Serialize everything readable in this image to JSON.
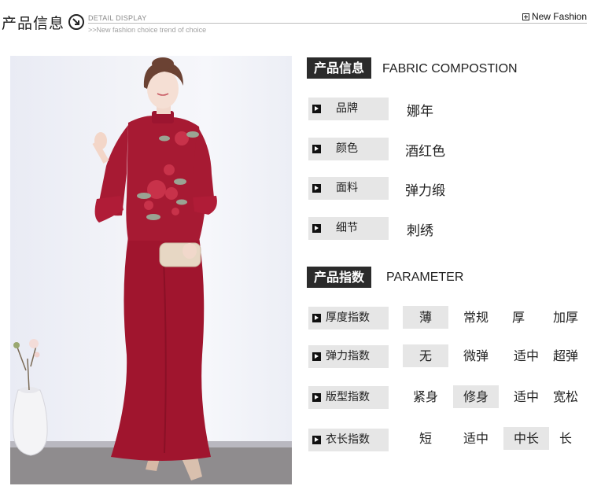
{
  "header": {
    "title": "产品信息",
    "en_line1": "DETAIL DISPLAY",
    "en_line2": ">>New fashion choice  trend of choice",
    "right_label": "New Fashion"
  },
  "product_info": {
    "tag": "产品信息",
    "title_en": "FABRIC COMPOSTION",
    "rows": [
      {
        "label": "品牌",
        "value": "娜年"
      },
      {
        "label": "颜色",
        "value": "酒红色"
      },
      {
        "label": "面料",
        "value": "弹力缎"
      },
      {
        "label": "细节",
        "value": "刺绣"
      }
    ]
  },
  "parameters": {
    "tag": "产品指数",
    "title_en": "PARAMETER",
    "rows": [
      {
        "label": "厚度指数",
        "options": [
          "薄",
          "常规",
          "厚",
          "加厚"
        ],
        "selected": 0
      },
      {
        "label": "弹力指数",
        "options": [
          "无",
          "微弹",
          "适中",
          "超弹"
        ],
        "selected": 0
      },
      {
        "label": "版型指数",
        "options": [
          "紧身",
          "修身",
          "适中",
          "宽松"
        ],
        "selected": 1
      },
      {
        "label": "衣长指数",
        "options": [
          "短",
          "适中",
          "中长",
          "长"
        ],
        "selected": 2
      }
    ]
  },
  "colors": {
    "dress": "#a0152e",
    "tag_bg": "#2b2b2b",
    "label_bg": "#e6e6e6"
  }
}
